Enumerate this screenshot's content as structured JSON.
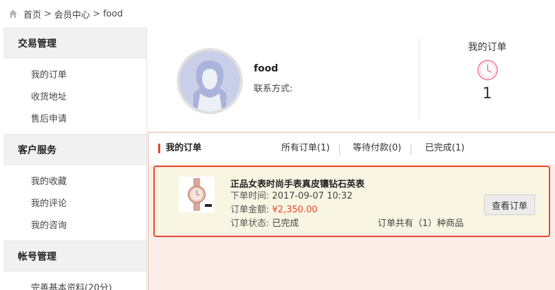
{
  "breadcrumb": {
    "home_icon": "home-icon",
    "items": [
      "首页",
      "会员中心",
      "food"
    ],
    "separator": ">"
  },
  "sidebar": {
    "groups": [
      {
        "title": "交易管理",
        "items": [
          "我的订单",
          "收货地址",
          "售后申请"
        ]
      },
      {
        "title": "客户服务",
        "items": [
          "我的收藏",
          "我的评论",
          "我的咨询"
        ]
      },
      {
        "title": "帐号管理",
        "items": [
          "完善基本资料(20分)"
        ]
      }
    ]
  },
  "profile": {
    "username": "food",
    "contact_label": "联系方式:",
    "orders_title": "我的订单",
    "orders_icon": "clock-icon",
    "orders_count": "1"
  },
  "orders": {
    "title": "我的订单",
    "tabs": [
      "所有订单(1)",
      "等待付款(0)",
      "已完成(1)"
    ],
    "list": [
      {
        "product_name": "正品女表时尚手表真皮镶钻石英表",
        "time_label": "下单时间:",
        "time_value": "2017-09-07 10:32",
        "amount_label": "订单金额:",
        "amount_value": "¥2,350.00",
        "status_label": "订单状态:",
        "status_value": "已完成",
        "item_count_text": "订单共有（1）种商品",
        "view_button": "查看订单"
      }
    ]
  },
  "colors": {
    "accent": "#e8462d",
    "sidebar_header_bg": "#f1f1f1",
    "order_card_bg": "#f9f5e3",
    "clock": "#f0708f"
  }
}
